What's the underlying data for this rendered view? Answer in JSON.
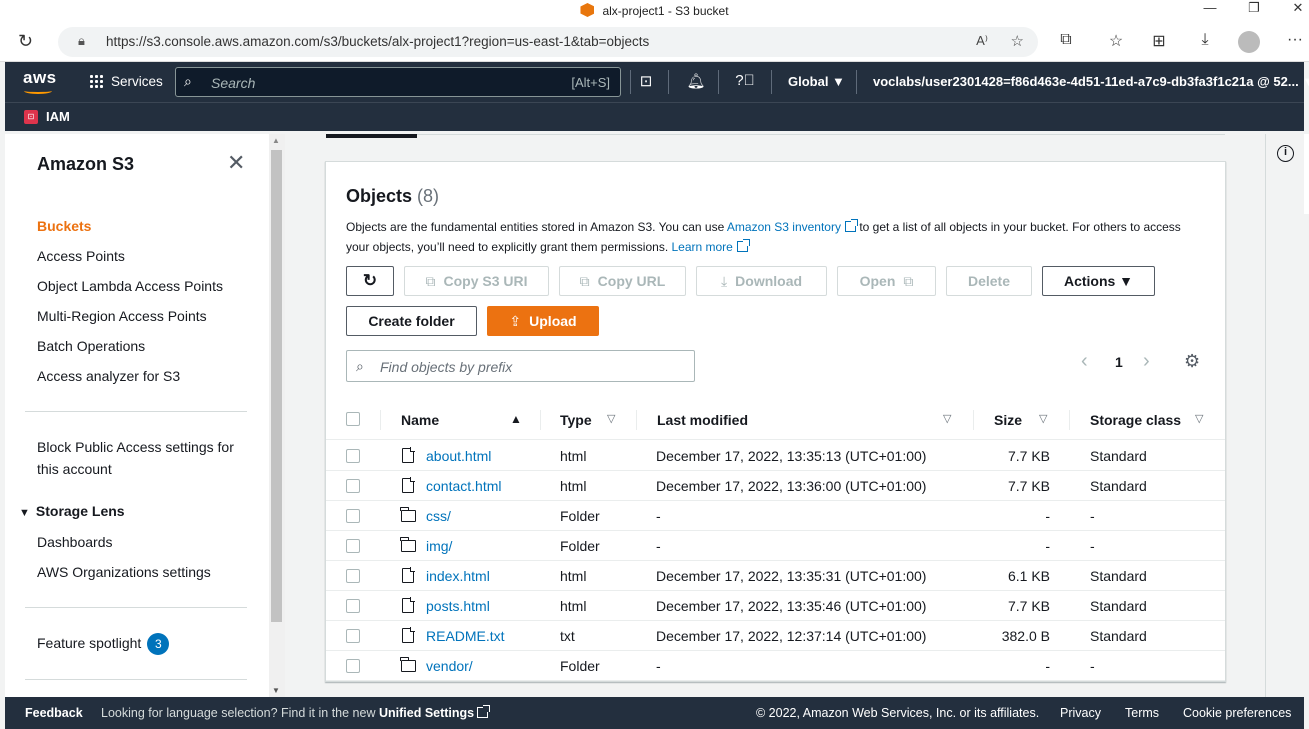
{
  "browser": {
    "tab_title": "alx-project1 - S3 bucket",
    "url": "https://s3.console.aws.amazon.com/s3/buckets/alx-project1?region=us-east-1&tab=objects",
    "minimize": "—",
    "restore": "❐",
    "close": "✕",
    "reload": "↻",
    "more": "···"
  },
  "aws_nav": {
    "logo": "aws",
    "services_label": "Services",
    "search_placeholder": "Search",
    "search_shortcut": "[Alt+S]",
    "region_label": "Global ▼",
    "account_label": "voclabs/user2301428=f86d463e-4d51-11ed-a7c9-db3fa3f1c21a @ 52... ▼",
    "favorite": "IAM"
  },
  "sidebar": {
    "title": "Amazon S3",
    "items": [
      {
        "label": "Buckets",
        "active": true
      },
      {
        "label": "Access Points"
      },
      {
        "label": "Object Lambda Access Points"
      },
      {
        "label": "Multi-Region Access Points"
      },
      {
        "label": "Batch Operations"
      },
      {
        "label": "Access analyzer for S3"
      }
    ],
    "block_public_line1": "Block Public Access settings for",
    "block_public_line2": "this account",
    "storage_lens": {
      "title": "Storage Lens",
      "items": [
        "Dashboards",
        "AWS Organizations settings"
      ]
    },
    "feature_spotlight": "Feature spotlight",
    "feature_count": "3"
  },
  "objects": {
    "title": "Objects",
    "count": "(8)",
    "desc_part1": "Objects are the fundamental entities stored in Amazon S3. You can use ",
    "desc_link1": "Amazon S3 inventory",
    "desc_part2": " to get a list of all objects in your bucket. For others to access your objects, you’ll need to explicitly grant them permissions. ",
    "desc_link2": "Learn more",
    "buttons": {
      "copy_s3_uri": "Copy S3 URI",
      "copy_url": "Copy URL",
      "download": "Download",
      "open": "Open",
      "delete": "Delete",
      "actions": "Actions ▼",
      "create_folder": "Create folder",
      "upload": "Upload"
    },
    "prefix_placeholder": "Find objects by prefix",
    "page": "1",
    "columns": {
      "name": "Name",
      "type": "Type",
      "last_modified": "Last modified",
      "size": "Size",
      "storage_class": "Storage class"
    },
    "rows": [
      {
        "name": "about.html",
        "type": "html",
        "modified": "December 17, 2022, 13:35:13 (UTC+01:00)",
        "size": "7.7 KB",
        "class": "Standard",
        "kind": "file"
      },
      {
        "name": "contact.html",
        "type": "html",
        "modified": "December 17, 2022, 13:36:00 (UTC+01:00)",
        "size": "7.7 KB",
        "class": "Standard",
        "kind": "file"
      },
      {
        "name": "css/",
        "type": "Folder",
        "modified": "-",
        "size": "-",
        "class": "-",
        "kind": "folder"
      },
      {
        "name": "img/",
        "type": "Folder",
        "modified": "-",
        "size": "-",
        "class": "-",
        "kind": "folder"
      },
      {
        "name": "index.html",
        "type": "html",
        "modified": "December 17, 2022, 13:35:31 (UTC+01:00)",
        "size": "6.1 KB",
        "class": "Standard",
        "kind": "file"
      },
      {
        "name": "posts.html",
        "type": "html",
        "modified": "December 17, 2022, 13:35:46 (UTC+01:00)",
        "size": "7.7 KB",
        "class": "Standard",
        "kind": "file"
      },
      {
        "name": "README.txt",
        "type": "txt",
        "modified": "December 17, 2022, 12:37:14 (UTC+01:00)",
        "size": "382.0 B",
        "class": "Standard",
        "kind": "file"
      },
      {
        "name": "vendor/",
        "type": "Folder",
        "modified": "-",
        "size": "-",
        "class": "-",
        "kind": "folder"
      }
    ]
  },
  "footer": {
    "feedback": "Feedback",
    "lang_text": "Looking for language selection? Find it in the new",
    "unified": "Unified Settings",
    "copyright": "© 2022, Amazon Web Services, Inc. or its affiliates.",
    "privacy": "Privacy",
    "terms": "Terms",
    "cookies": "Cookie preferences"
  },
  "colors": {
    "nav_bg": "#232f3e",
    "accent": "#ec7211",
    "link": "#0073bb"
  }
}
